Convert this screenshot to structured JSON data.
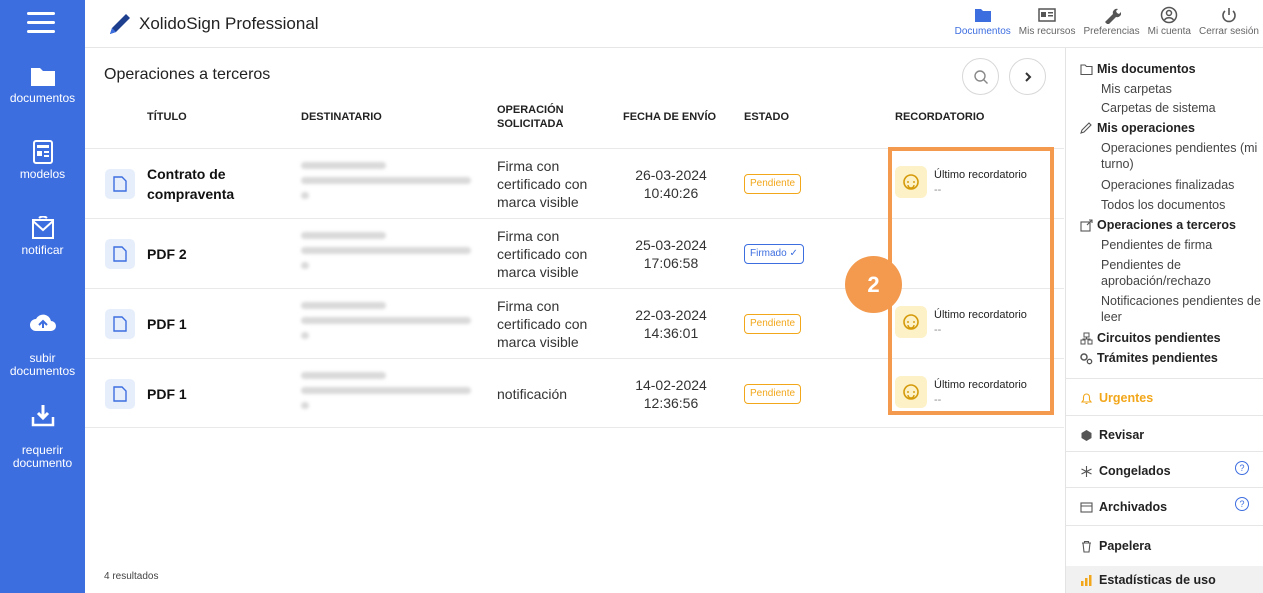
{
  "app": {
    "title": "XolidoSign Professional"
  },
  "left_nav": [
    {
      "label": "documentos",
      "icon": "folder-icon"
    },
    {
      "label": "modelos",
      "icon": "template-icon"
    },
    {
      "label": "notificar",
      "icon": "notify-icon"
    },
    {
      "label": "subir\ndocumentos",
      "icon": "upload-icon"
    },
    {
      "label": "requerir\ndocumento",
      "icon": "download-icon"
    }
  ],
  "top_nav": [
    {
      "label": "Documentos",
      "icon": "folder-icon",
      "active": true
    },
    {
      "label": "Mis recursos",
      "icon": "resources-icon"
    },
    {
      "label": "Preferencias",
      "icon": "wrench-icon"
    },
    {
      "label": "Mi cuenta",
      "icon": "user-icon"
    },
    {
      "label": "Cerrar sesión",
      "icon": "power-icon"
    }
  ],
  "page": {
    "title": "Operaciones a terceros",
    "results": "4 resultados"
  },
  "table": {
    "headers": {
      "title": "TÍTULO",
      "recipient": "DESTINATARIO",
      "operation": "OPERACIÓN SOLICITADA",
      "sent_date": "FECHA DE ENVÍO",
      "status": "ESTADO",
      "reminder": "RECORDATORIO"
    },
    "rows": [
      {
        "title": "Contrato de compraventa",
        "operation": "Firma con certificado con marca visible",
        "date": "26-03-2024",
        "time": "10:40:26",
        "status": "Pendiente",
        "reminder_label": "Último recordatorio",
        "reminder_value": "--"
      },
      {
        "title": "PDF 2",
        "operation": "Firma con certificado con marca visible",
        "date": "25-03-2024",
        "time": "17:06:58",
        "status": "Firmado",
        "reminder_label": "",
        "reminder_value": ""
      },
      {
        "title": "PDF 1",
        "operation": "Firma con certificado con marca visible",
        "date": "22-03-2024",
        "time": "14:36:01",
        "status": "Pendiente",
        "reminder_label": "Último recordatorio",
        "reminder_value": "--"
      },
      {
        "title": "PDF 1",
        "operation": "notificación",
        "date": "14-02-2024",
        "time": "12:36:56",
        "status": "Pendiente",
        "reminder_label": "Último recordatorio",
        "reminder_value": "--"
      }
    ]
  },
  "step_badge": "2",
  "right_nav": {
    "mis_documentos": {
      "heading": "Mis documentos",
      "items": [
        "Mis carpetas",
        "Carpetas de sistema"
      ]
    },
    "mis_operaciones": {
      "heading": "Mis operaciones",
      "items": [
        "Operaciones pendientes (mi turno)",
        "Operaciones finalizadas",
        "Todos los documentos"
      ]
    },
    "operaciones_terceros": {
      "heading": "Operaciones a terceros",
      "items": [
        "Pendientes de firma",
        "Pendientes de aprobación/rechazo",
        "Notificaciones pendientes de leer"
      ]
    },
    "circuitos": "Circuitos pendientes",
    "tramites": "Trámites pendientes",
    "urgentes": "Urgentes",
    "revisar": "Revisar",
    "congelados": "Congelados",
    "archivados": "Archivados",
    "papelera": "Papelera",
    "estadisticas": "Estadísticas de uso"
  },
  "colors": {
    "primary": "#3d6ee0",
    "pending": "#f2a71b",
    "highlight": "#f39a4e",
    "urgent": "#f2a71b"
  }
}
